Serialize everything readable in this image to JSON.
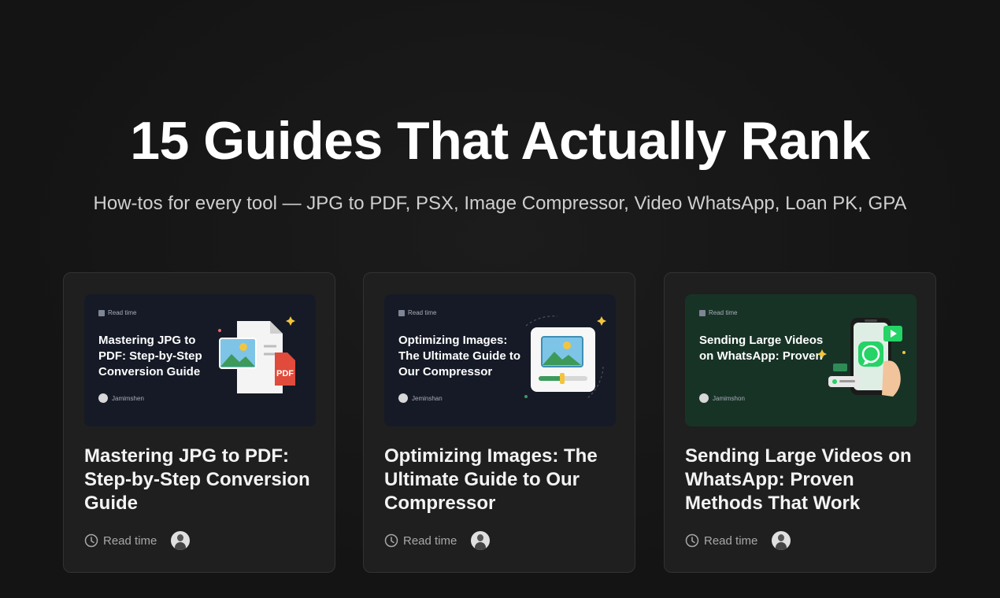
{
  "hero": {
    "title": "15 Guides That Actually Rank",
    "subtitle": "How-tos for every tool — JPG to PDF, PSX, Image Compressor, Video WhatsApp, Loan PK, GPA"
  },
  "cards": [
    {
      "thumb_read": "Read time",
      "thumb_title": "Mastering JPG to PDF: Step-by-Step Conversion Guide",
      "thumb_author": "Jamimshen",
      "thumb_badge": "PDF",
      "title": "Mastering JPG to PDF: Step-by-Step Conversion Guide",
      "read_label": "Read time",
      "icon": "image-to-pdf-icon"
    },
    {
      "thumb_read": "Read time",
      "thumb_title": "Optimizing Images: The Ultimate Guide to Our Compressor",
      "thumb_author": "Jeminshan",
      "title": "Optimizing Images: The Ultimate Guide to Our Compressor",
      "read_label": "Read time",
      "icon": "image-compressor-icon"
    },
    {
      "thumb_read": "Read time",
      "thumb_title": "Sending Large Videos on WhatsApp: Proven",
      "thumb_author": "Jamimshon",
      "title": "Sending Large Videos on WhatsApp: Proven Methods That Work",
      "read_label": "Read time",
      "icon": "whatsapp-video-icon"
    }
  ],
  "colors": {
    "background": "#161616",
    "card": "#1f1f1f",
    "thumb_dark": "#151a26",
    "thumb_green": "#173326",
    "pdf_red": "#e04b3c",
    "whatsapp_green": "#25d366"
  }
}
